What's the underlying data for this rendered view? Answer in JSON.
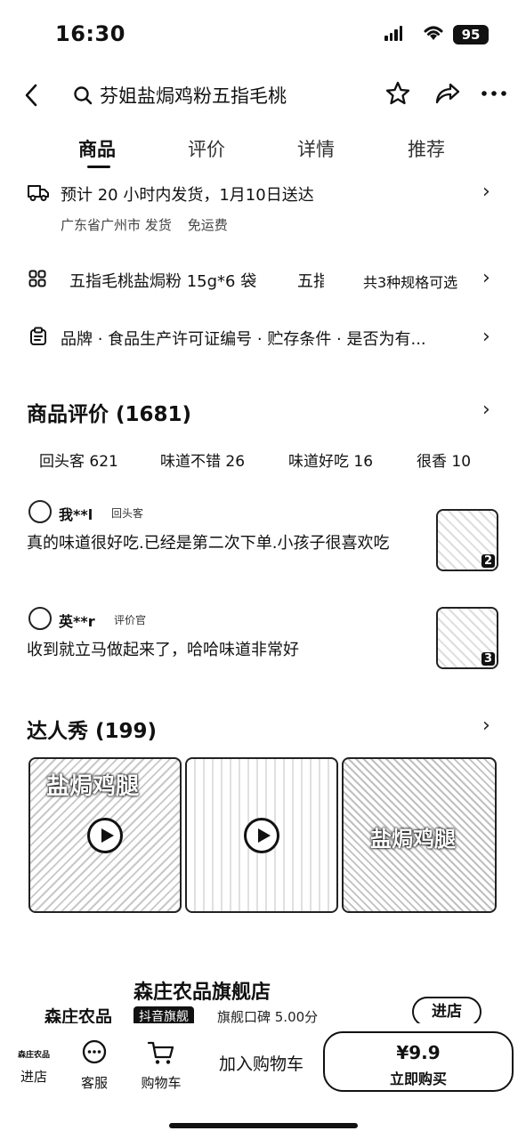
{
  "status": {
    "time": "16:30",
    "battery": "95"
  },
  "nav": {
    "search_text": "芬姐盐焗鸡粉五指毛桃"
  },
  "tabs": [
    "商品",
    "评价",
    "详情",
    "推荐"
  ],
  "delivery": {
    "main": "预计 20 小时内发货，1月10日送达",
    "origin": "广东省广州市 发货",
    "shipping": "免运费"
  },
  "spec": {
    "option1": "五指毛桃盐焗粉 15g*6 袋",
    "option2": "五指毛",
    "count": "共3种规格可选"
  },
  "params": {
    "text": "品牌 · 食品生产许可证编号 · 贮存条件 · 是否为有..."
  },
  "reviews": {
    "title": "商品评价 (1681)",
    "tags": [
      "回头客  621",
      "味道不错  26",
      "味道好吃  16",
      "很香  10"
    ],
    "items": [
      {
        "user": "我**l",
        "badge": "回头客",
        "text": "真的味道很好吃.已经是第二次下单.小孩子很喜欢吃",
        "photos": "2"
      },
      {
        "user": "英**r",
        "badge": "评价官",
        "text": "收到就立马做起来了，哈哈味道非常好",
        "photos": "3"
      }
    ]
  },
  "talent": {
    "title": "达人秀 (199)",
    "video1_caption": "盐焗鸡腿",
    "video3_caption": "盐焗鸡腿"
  },
  "store": {
    "name": "森庄农品旗舰店",
    "logo_text": "森庄农品",
    "badge": "抖音旗舰",
    "rating": "旗舰口碑  5.00分",
    "enter": "进店"
  },
  "bottom": {
    "store_label": "进店",
    "store_logo": "森庄农品",
    "service_label": "客服",
    "cart_label": "购物车",
    "add_cart": "加入购物车",
    "price": "¥9.9",
    "buy_now": "立即购买"
  },
  "icons": [
    "back-icon",
    "search-icon",
    "star-icon",
    "share-icon",
    "more-icon",
    "truck-icon",
    "grid-icon",
    "clipboard-icon",
    "chevron-right-icon",
    "play-icon",
    "chat-icon",
    "cart-icon"
  ]
}
